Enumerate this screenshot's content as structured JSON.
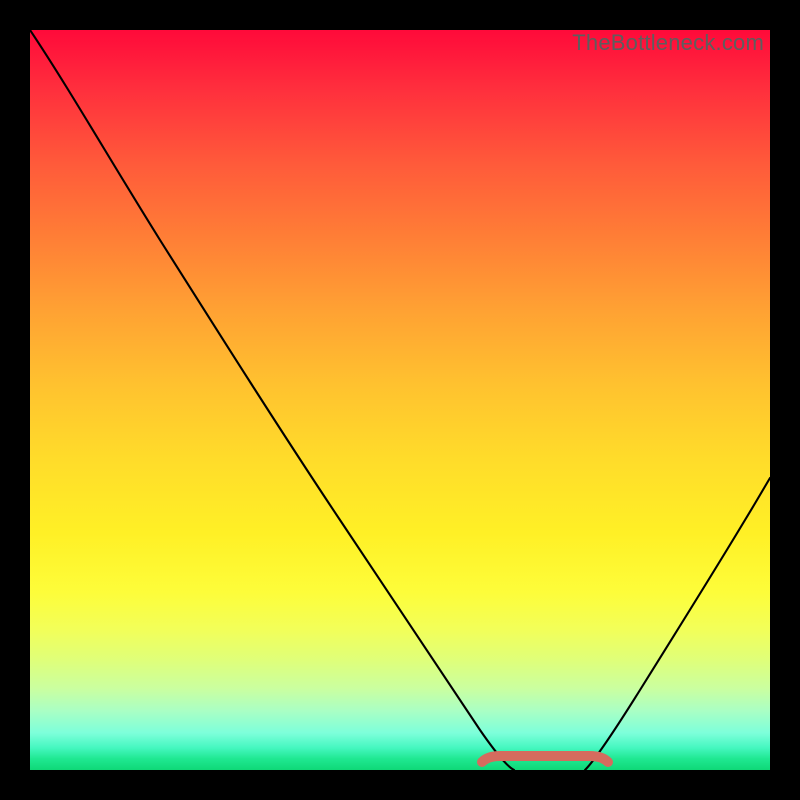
{
  "watermark": "TheBottleneck.com",
  "colors": {
    "frame": "#000000",
    "curve": "#000000",
    "bump": "#d56b5e"
  },
  "chart_data": {
    "type": "line",
    "title": "",
    "xlabel": "",
    "ylabel": "",
    "xlim": [
      0,
      100
    ],
    "ylim": [
      0,
      100
    ],
    "series": [
      {
        "name": "bottleneck-curve-left",
        "x": [
          0,
          5,
          10,
          15,
          20,
          25,
          30,
          35,
          40,
          45,
          50,
          55,
          60,
          63,
          65
        ],
        "values": [
          100,
          93,
          86,
          78,
          70,
          62,
          54,
          46,
          38,
          30,
          22,
          14,
          7,
          2,
          0
        ]
      },
      {
        "name": "bottleneck-curve-right",
        "x": [
          74,
          78,
          82,
          86,
          90,
          94,
          97,
          100
        ],
        "values": [
          0,
          5,
          12,
          20,
          29,
          38,
          45,
          52
        ]
      },
      {
        "name": "optimal-band",
        "x": [
          60,
          62,
          64,
          66,
          68,
          70,
          72,
          74,
          76,
          78
        ],
        "values": [
          1.2,
          0.6,
          0.3,
          0.3,
          0.3,
          0.3,
          0.3,
          0.3,
          0.6,
          1.2
        ]
      }
    ],
    "gradient_stops": [
      {
        "pos": 0,
        "color": "#ff0a3a"
      },
      {
        "pos": 0.5,
        "color": "#ffdc2a"
      },
      {
        "pos": 0.82,
        "color": "#fdfd3a"
      },
      {
        "pos": 1.0,
        "color": "#0fd877"
      }
    ]
  }
}
